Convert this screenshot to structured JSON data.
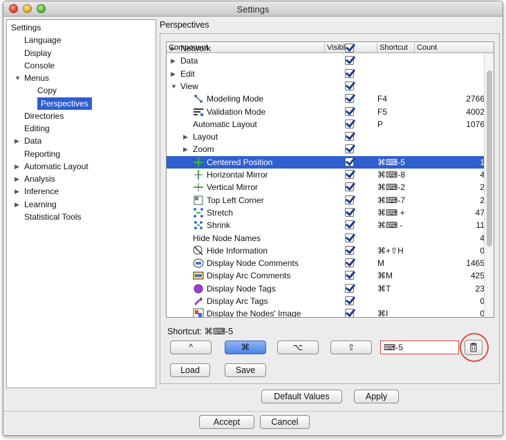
{
  "window": {
    "title": "Settings"
  },
  "sidebar": {
    "items": [
      {
        "label": "Settings",
        "level": 0,
        "expander": ""
      },
      {
        "label": "Language",
        "level": 1,
        "expander": ""
      },
      {
        "label": "Display",
        "level": 1,
        "expander": ""
      },
      {
        "label": "Console",
        "level": 1,
        "expander": ""
      },
      {
        "label": "Menus",
        "level": 1,
        "expander": "▼"
      },
      {
        "label": "Copy",
        "level": 2,
        "expander": ""
      },
      {
        "label": "Perspectives",
        "level": 2,
        "expander": "",
        "selected": true
      },
      {
        "label": "Directories",
        "level": 1,
        "expander": ""
      },
      {
        "label": "Editing",
        "level": 1,
        "expander": ""
      },
      {
        "label": "Data",
        "level": 1,
        "expander": "▶"
      },
      {
        "label": "Reporting",
        "level": 1,
        "expander": ""
      },
      {
        "label": "Automatic Layout",
        "level": 1,
        "expander": "▶"
      },
      {
        "label": "Analysis",
        "level": 1,
        "expander": "▶"
      },
      {
        "label": "Inference",
        "level": 1,
        "expander": "▶"
      },
      {
        "label": "Learning",
        "level": 1,
        "expander": "▶"
      },
      {
        "label": "Statistical Tools",
        "level": 1,
        "expander": ""
      }
    ]
  },
  "panel": {
    "title": "Perspectives",
    "columns": {
      "component": "Component",
      "visible": "Visible",
      "shortcut": "Shortcut",
      "count": "Count"
    },
    "rows": [
      {
        "label": "Network",
        "level": 0,
        "expander": "▶",
        "icon": "",
        "shortcut": "",
        "count": ""
      },
      {
        "label": "Data",
        "level": 0,
        "expander": "▶",
        "icon": "",
        "shortcut": "",
        "count": ""
      },
      {
        "label": "Edit",
        "level": 0,
        "expander": "▶",
        "icon": "",
        "shortcut": "",
        "count": ""
      },
      {
        "label": "View",
        "level": 0,
        "expander": "▼",
        "icon": "",
        "shortcut": "",
        "count": ""
      },
      {
        "label": "Modeling Mode",
        "level": 1,
        "expander": "",
        "icon": "modeling-mode-icon",
        "shortcut": "F4",
        "count": "2766"
      },
      {
        "label": "Validation Mode",
        "level": 1,
        "expander": "",
        "icon": "validation-mode-icon",
        "shortcut": "F5",
        "count": "4002"
      },
      {
        "label": "Automatic Layout",
        "level": 1,
        "expander": "",
        "icon": "",
        "shortcut": "P",
        "count": "1076"
      },
      {
        "label": "Layout",
        "level": 1,
        "expander": "▶",
        "icon": "",
        "shortcut": "",
        "count": ""
      },
      {
        "label": "Zoom",
        "level": 1,
        "expander": "▶",
        "icon": "",
        "shortcut": "",
        "count": ""
      },
      {
        "label": "Centered Position",
        "level": 1,
        "expander": "",
        "icon": "centered-position-icon",
        "shortcut": "⌘⌨-5",
        "count": "1",
        "selected": true
      },
      {
        "label": "Horizontal Mirror",
        "level": 1,
        "expander": "",
        "icon": "horizontal-mirror-icon",
        "shortcut": "⌘⌨-8",
        "count": "4"
      },
      {
        "label": "Vertical Mirror",
        "level": 1,
        "expander": "",
        "icon": "vertical-mirror-icon",
        "shortcut": "⌘⌨-2",
        "count": "2"
      },
      {
        "label": "Top Left Corner",
        "level": 1,
        "expander": "",
        "icon": "top-left-corner-icon",
        "shortcut": "⌘⌨-7",
        "count": "2"
      },
      {
        "label": "Stretch",
        "level": 1,
        "expander": "",
        "icon": "stretch-icon",
        "shortcut": "⌘⌨ +",
        "count": "47"
      },
      {
        "label": "Shrink",
        "level": 1,
        "expander": "",
        "icon": "shrink-icon",
        "shortcut": "⌘⌨ -",
        "count": "11"
      },
      {
        "label": "Hide Node Names",
        "level": 1,
        "expander": "",
        "icon": "",
        "shortcut": "",
        "count": "4"
      },
      {
        "label": "Hide Information",
        "level": 1,
        "expander": "",
        "icon": "hide-information-icon",
        "shortcut": "⌘+⇧H",
        "count": "0"
      },
      {
        "label": "Display Node Comments",
        "level": 1,
        "expander": "",
        "icon": "node-comments-icon",
        "shortcut": "M",
        "count": "1465"
      },
      {
        "label": "Display Arc Comments",
        "level": 1,
        "expander": "",
        "icon": "arc-comments-icon",
        "shortcut": "⌘M",
        "count": "425"
      },
      {
        "label": "Display Node Tags",
        "level": 1,
        "expander": "",
        "icon": "node-tags-icon",
        "shortcut": "⌘T",
        "count": "23"
      },
      {
        "label": "Display Arc Tags",
        "level": 1,
        "expander": "",
        "icon": "arc-tags-icon",
        "shortcut": "",
        "count": "0"
      },
      {
        "label": "Display the Nodes' Image",
        "level": 1,
        "expander": "",
        "icon": "nodes-image-icon",
        "shortcut": "⌘I",
        "count": "0"
      }
    ],
    "shortcut_label": "Shortcut: ⌘⌨-5",
    "modifier_buttons": {
      "ctrl": "^",
      "cmd": "⌘",
      "alt": "⌥",
      "shift": "⇧"
    },
    "key_field_value": "⌨-5",
    "load_label": "Load",
    "save_label": "Save"
  },
  "footer": {
    "default_values_label": "Default Values",
    "apply_label": "Apply",
    "accept_label": "Accept",
    "cancel_label": "Cancel"
  },
  "colors": {
    "selection": "#2f5ed1",
    "highlight_ring": "#dd4f42",
    "check": "#1d3f8a"
  }
}
